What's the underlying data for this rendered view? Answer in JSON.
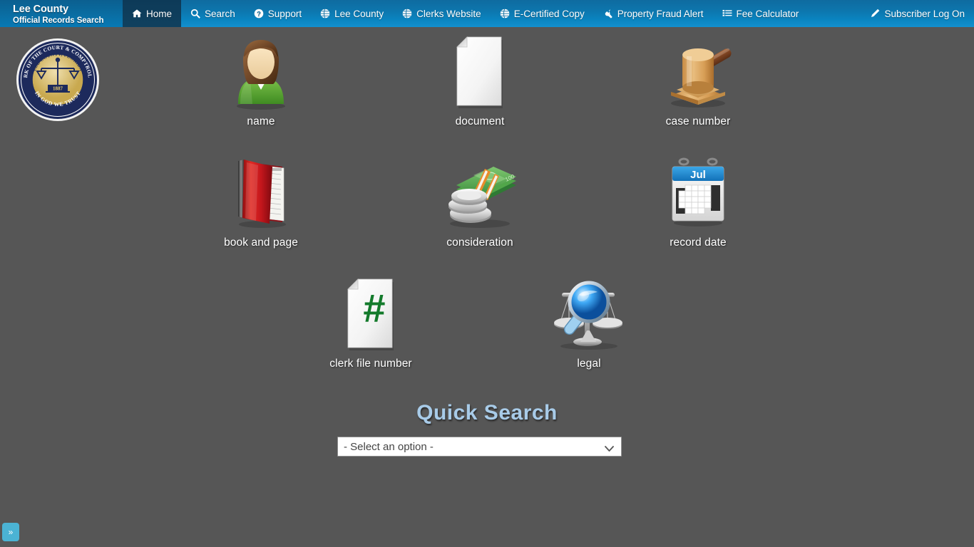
{
  "brand": {
    "line1": "Lee County",
    "line2": "Official Records Search"
  },
  "nav": {
    "items": [
      {
        "label": "Home",
        "icon": "home-icon",
        "active": true
      },
      {
        "label": "Search",
        "icon": "search-icon",
        "active": false
      },
      {
        "label": "Support",
        "icon": "question-circle-icon",
        "active": false
      },
      {
        "label": "Lee County",
        "icon": "globe-icon",
        "active": false
      },
      {
        "label": "Clerks Website",
        "icon": "globe-icon",
        "active": false
      },
      {
        "label": "E-Certified Copy",
        "icon": "globe-icon",
        "active": false
      },
      {
        "label": "Property Fraud Alert",
        "icon": "wrench-icon",
        "active": false
      },
      {
        "label": "Fee Calculator",
        "icon": "list-icon",
        "active": false
      }
    ],
    "right": {
      "label": "Subscriber Log On",
      "icon": "pencil-icon"
    }
  },
  "seal": {
    "outer_top_text": "CLERK OF THE COURT & COMPTROLLER",
    "inner_top_text": "LEE COUNTY, FLORIDA",
    "bottom_text": "IN GOD WE TRUST",
    "year": "1887",
    "emblem": "scales-of-justice"
  },
  "search_tiles": [
    {
      "label": "name",
      "icon": "person-icon"
    },
    {
      "label": "document",
      "icon": "document-icon"
    },
    {
      "label": "case number",
      "icon": "gavel-icon"
    },
    {
      "label": "book and page",
      "icon": "red-book-icon"
    },
    {
      "label": "consideration",
      "icon": "money-coins-icon"
    },
    {
      "label": "record date",
      "icon": "calendar-icon"
    },
    {
      "label": "clerk file number",
      "icon": "hash-page-icon"
    },
    {
      "label": "legal",
      "icon": "scales-magnifier-icon"
    }
  ],
  "calendar": {
    "month": "Jul"
  },
  "quick_search": {
    "title": "Quick Search",
    "selected_option": "- Select an option -",
    "options": [
      "- Select an option -"
    ]
  },
  "bottom_toggle": {
    "label": "»"
  },
  "colors": {
    "page_background": "#565656",
    "nav_gradient_top": "#0f6ba0",
    "nav_gradient_bottom": "#1390ce",
    "nav_active": "#113f5e",
    "quick_search_title": "#a8cbe8",
    "toggle": "#4bb3d4"
  }
}
